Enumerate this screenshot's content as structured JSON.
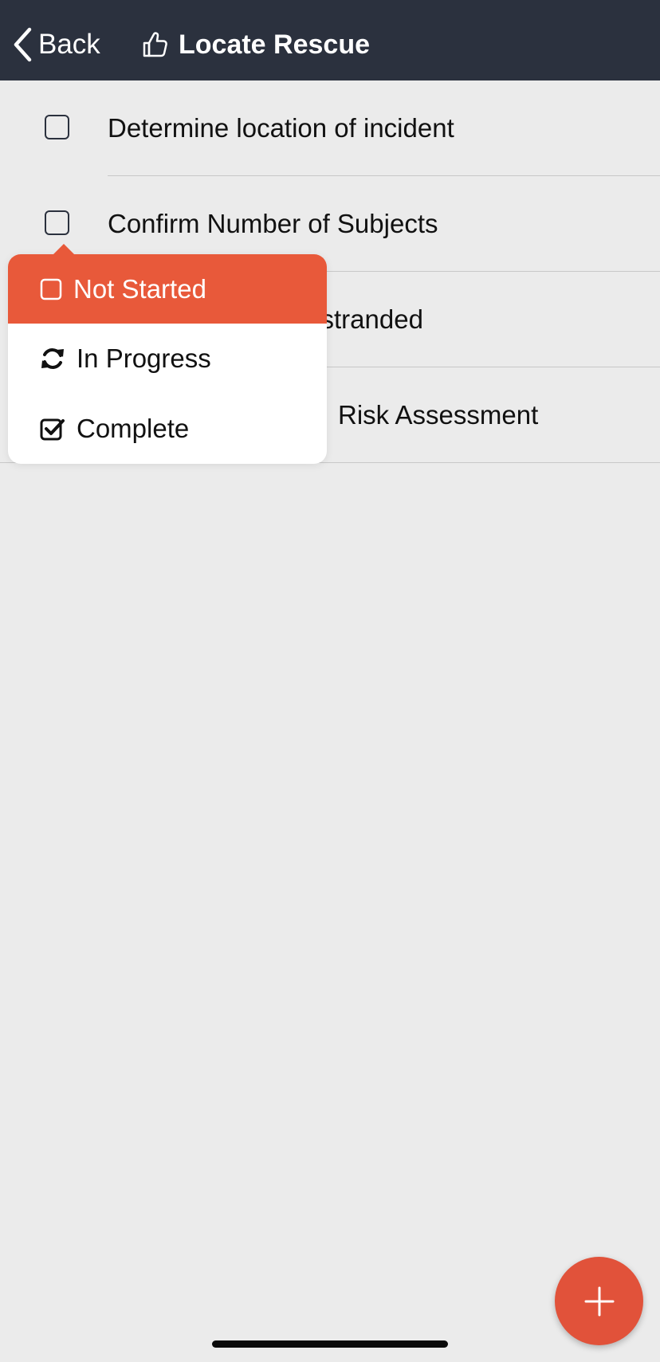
{
  "navbar": {
    "back_label": "Back",
    "back_icon": "chevron-left-icon",
    "title": "Locate Rescue",
    "title_icon": "thumbs-up-icon"
  },
  "tasks": [
    {
      "label": "Determine location of incident",
      "status": "not-started"
    },
    {
      "label": "Confirm Number of Subjects",
      "status": "not-started"
    },
    {
      "label": "or stranded",
      "status": "not-started"
    },
    {
      "label": "Risk Assessment",
      "status": "not-started"
    }
  ],
  "status_menu": {
    "options": [
      {
        "label": "Not Started",
        "icon": "square-outline-icon",
        "selected": true
      },
      {
        "label": "In Progress",
        "icon": "refresh-icon",
        "selected": false
      },
      {
        "label": "Complete",
        "icon": "checked-square-icon",
        "selected": false
      }
    ]
  },
  "fab": {
    "icon": "plus-icon"
  },
  "colors": {
    "navbar_bg": "#2b313e",
    "accent": "#e8593a",
    "fab": "#e1523a",
    "page_bg": "#ebebeb"
  }
}
